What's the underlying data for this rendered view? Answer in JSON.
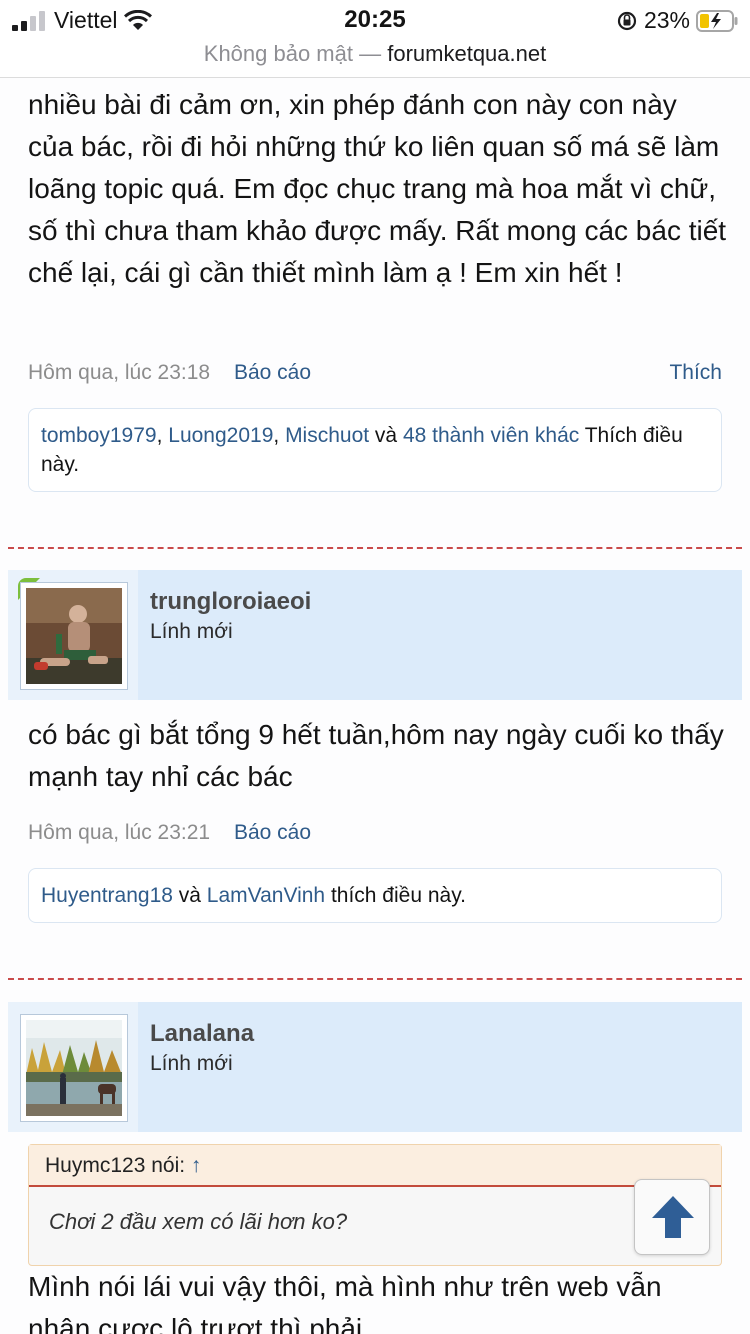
{
  "status_bar": {
    "carrier": "Viettel",
    "time": "20:25",
    "battery": "23%"
  },
  "url_bar": {
    "security": "Không bảo mật —",
    "domain": "forumketqua.net"
  },
  "posts": [
    {
      "text": "nhiều bài đi cảm ơn, xin phép đánh con này con này của bác, rồi đi hỏi những thứ ko liên quan số má sẽ làm loãng topic quá. Em đọc chục trang mà hoa mắt vì chữ, số thì chưa tham khảo được mấy. Rất mong các bác tiết chế lại, cái gì cần thiết mình làm ạ ! Em xin hết !",
      "timestamp": "Hôm qua, lúc 23:18",
      "report": "Báo cáo",
      "like": "Thích",
      "likes": {
        "users": [
          "tomboy1979",
          "Luong2019",
          "Mischuot"
        ],
        "sep1": ", ",
        "sep2": ", ",
        "and": " và ",
        "others": "48 thành viên khác",
        "suffix": " Thích điều này."
      }
    },
    {
      "username": "trungloroiaeoi",
      "rank": "Lính mới",
      "text": "có bác gì bắt tổng 9 hết tuần,hôm nay ngày cuối ko thấy mạnh tay nhỉ các bác",
      "timestamp": "Hôm qua, lúc 23:21",
      "report": "Báo cáo",
      "likes": {
        "users": [
          "Huyentrang18",
          "LamVanVinh"
        ],
        "and": " và ",
        "suffix": " thích điều này."
      }
    },
    {
      "username": "Lanalana",
      "rank": "Lính mới",
      "quote": {
        "author": "Huymc123 nói: ",
        "arrow": "↑",
        "text": "Chơi 2 đầu xem có lãi hơn ko?"
      },
      "text": "Mình nói lái vui vậy thôi, mà hình như trên web vẫn nhận cược lô trượt thì phải"
    }
  ],
  "icons": [
    "signal-icon",
    "wifi-icon",
    "orientation-lock-icon",
    "battery-charging-icon",
    "scroll-top-arrow-icon"
  ]
}
